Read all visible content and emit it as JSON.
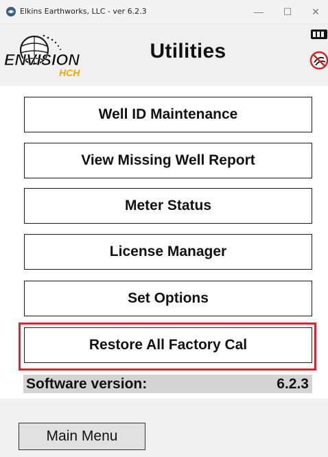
{
  "window": {
    "title": "Elkins Earthworks, LLC - ver 6.2.3",
    "minimize": "—",
    "maximize": "☐",
    "close": "✕"
  },
  "header": {
    "logo_main": "ENVISION",
    "logo_sub": "HCH",
    "title": "Utilities"
  },
  "menu": {
    "well_id": "Well ID Maintenance",
    "missing_well": "View Missing Well Report",
    "meter_status": "Meter Status",
    "license_manager": "License Manager",
    "set_options": "Set Options",
    "restore_cal": "Restore All Factory Cal"
  },
  "version": {
    "label": "Software version:",
    "value": "6.2.3"
  },
  "footer": {
    "main_menu": "Main Menu"
  },
  "colors": {
    "highlight": "#e0202a",
    "logo_sub": "#f2a900"
  }
}
